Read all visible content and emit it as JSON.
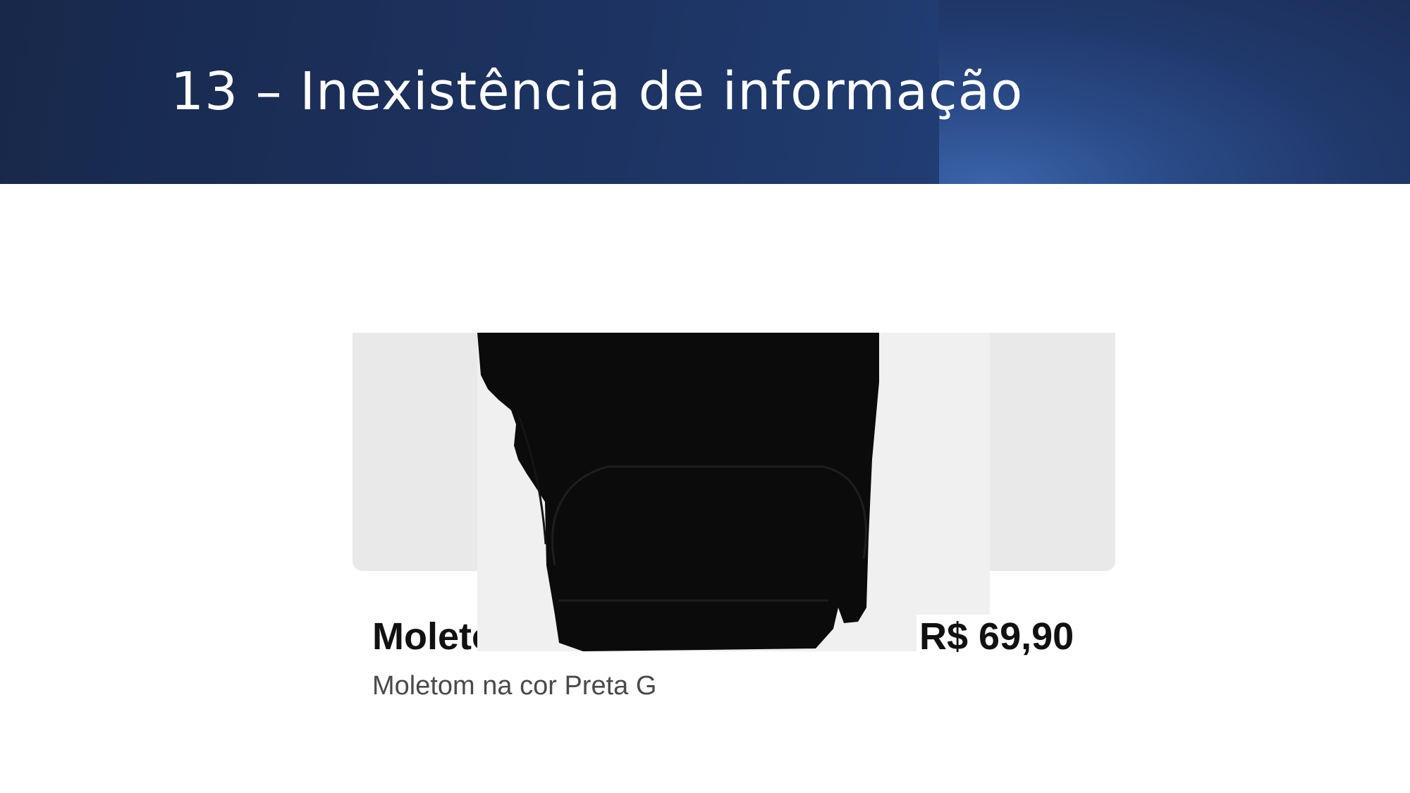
{
  "slide": {
    "title": "13 – Inexistência de informação"
  },
  "product": {
    "name": "Moletom J",
    "price": "R$ 69,90",
    "description": "Moletom na cor Preta G",
    "image_subject": "black-hoodie"
  },
  "colors": {
    "header": "#1d3463",
    "header_accent": "#3a64aa",
    "card_background": "#e9e9e9",
    "hoodie": "#0b0b0b"
  }
}
